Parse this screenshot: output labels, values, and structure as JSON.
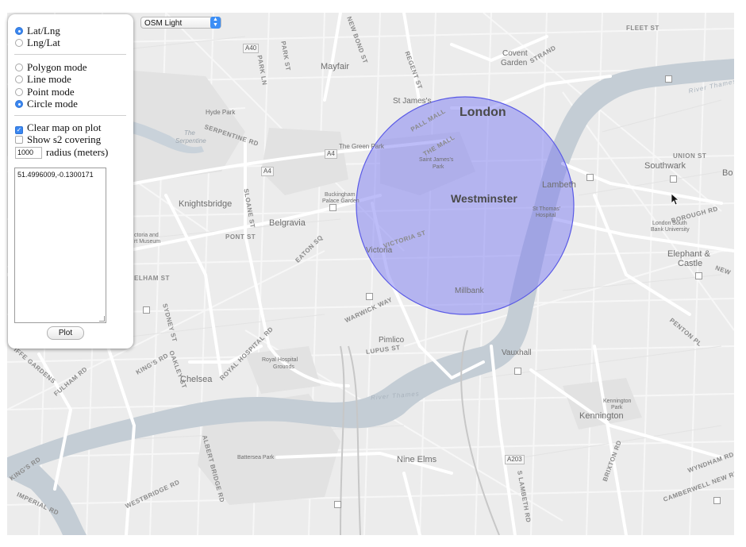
{
  "tile_layer": {
    "selected": "OSM Light"
  },
  "panel": {
    "coord_order": [
      {
        "label": "Lat/Lng",
        "selected": true
      },
      {
        "label": "Lng/Lat",
        "selected": false
      }
    ],
    "modes": [
      {
        "label": "Polygon mode",
        "selected": false
      },
      {
        "label": "Line mode",
        "selected": false
      },
      {
        "label": "Point mode",
        "selected": false
      },
      {
        "label": "Circle mode",
        "selected": true
      }
    ],
    "clear_map": {
      "label": "Clear map on plot",
      "checked": true
    },
    "show_s2": {
      "label": "Show s2 covering",
      "checked": false
    },
    "radius": {
      "value": "1000",
      "label": "radius (meters)"
    },
    "coords_text": "51.4996009,-0.1300171",
    "plot_label": "Plot"
  },
  "map": {
    "circle_color": "#7b7bf2",
    "places": {
      "london": "London",
      "westminster": "Westminster",
      "mayfair": "Mayfair",
      "covent_garden_1": "Covent",
      "covent_garden_2": "Garden",
      "st_james": "St James's",
      "hyde_park": "Hyde Park",
      "the_serpentine_1": "The",
      "the_serpentine_2": "Serpentine",
      "green_park": "The Green Park",
      "st_james_park_1": "Saint James's",
      "st_james_park_2": "Park",
      "buckingham_1": "Buckingham",
      "buckingham_2": "Palace Garden",
      "knightsbridge": "Knightsbridge",
      "belgravia": "Belgravia",
      "va_museum_1": "ctoria and",
      "va_museum_2": "rt Museum",
      "victoria": "Victoria",
      "lambeth": "Lambeth",
      "st_thomas_1": "St Thomas'",
      "st_thomas_2": "Hospital",
      "southwark": "Southwark",
      "lsbu_1": "London South",
      "lsbu_2": "Bank University",
      "elephant_1": "Elephant &",
      "elephant_2": "Castle",
      "millbank": "Millbank",
      "pimlico": "Pimlico",
      "vauxhall": "Vauxhall",
      "royal_hospital_1": "Royal Hospital",
      "royal_hospital_2": "Grounds",
      "chelsea": "Chelsea",
      "kennington_park_1": "Kennington",
      "kennington_park_2": "Park",
      "kennington": "Kennington",
      "battersea_park": "Battersea Park",
      "nine_elms": "Nine Elms",
      "river_thames_1": "River Thames",
      "river_thames_2": "River Thames",
      "bo": "Bo"
    },
    "roads": {
      "a40": "A40",
      "park_st": "PARK ST",
      "park_ln": "PARK LN",
      "new_bond_st": "NEW BOND ST",
      "regent_st": "REGENT ST",
      "strand": "STRAND",
      "fleet_st": "FLEET ST",
      "serpentine_rd": "SERPENTINE RD",
      "a4": "A4",
      "a4b": "A4",
      "pall_mall": "PALL MALL",
      "the_mall_1": "THE MALL",
      "the_mall_2": "THE MALL",
      "sloane_st": "SLOANE ST",
      "pont_st": "PONT ST",
      "eaton_sq": "EATON SQ",
      "victoria_st": "VICTORIA ST",
      "union_st": "UNION ST",
      "borough_rd": "BOROUGH RD",
      "new": "NEW",
      "elham_st": "ELHAM ST",
      "sydney_st": "SYDNEY ST",
      "warwick_way": "WARWICK WAY",
      "lupus_st": "LUPUS ST",
      "kings_rd": "KING'S RD",
      "oakley_st": "OAKLEY ST",
      "royal_hospital_rd": "ROYAL HOSPITAL RD",
      "fulham_rd": "FULHAM RD",
      "iffe_gardens": "IFFE GARDENS",
      "penton_pl": "PENTON PL",
      "albert_bridge_rd": "ALBERT BRIDGE RD",
      "westbridge_rd": "WESTBRIDGE RD",
      "kings_rd2": "KING'S RD",
      "imperial_rd": "IMPERIAL RD",
      "a203": "A203",
      "s_lambeth_rd": "S LAMBETH RD",
      "brixton_rd": "BRIXTON RD",
      "wyndham_rd": "WYNDHAM RD",
      "camberwell_new_rd": "CAMBERWELL NEW RD"
    }
  }
}
